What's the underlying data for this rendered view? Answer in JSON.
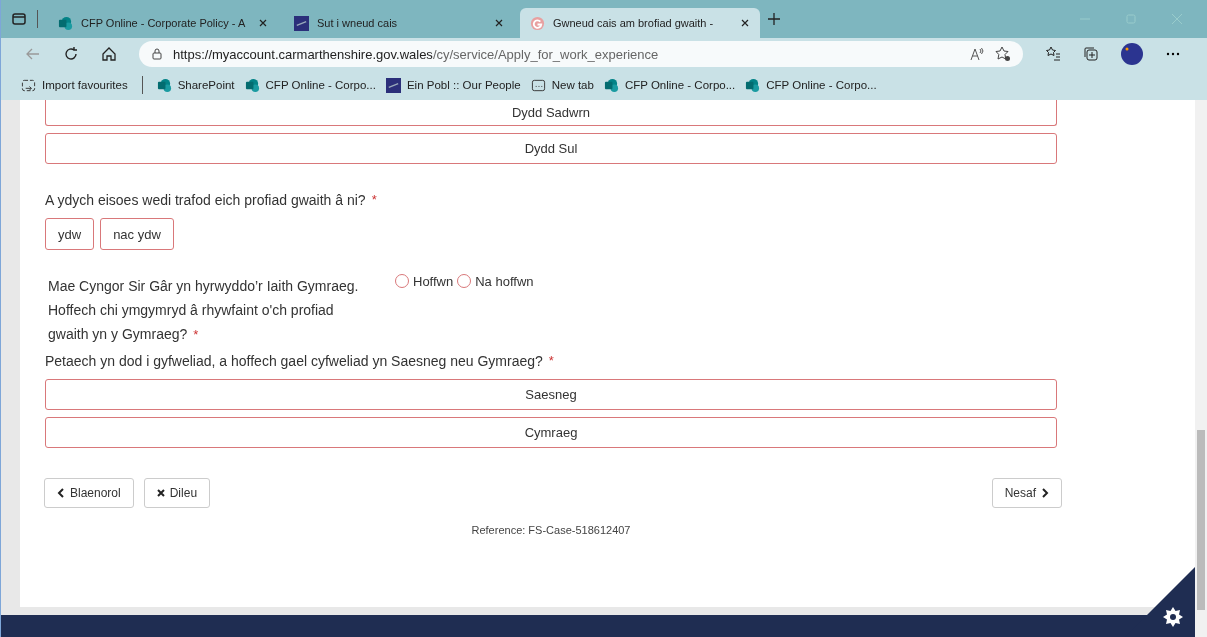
{
  "browser": {
    "tabs": [
      {
        "title": "CFP Online - Corporate Policy - A",
        "kind": "sharepoint",
        "selected": false
      },
      {
        "title": "Sut i wneud cais",
        "kind": "site",
        "selected": false
      },
      {
        "title": "Gwneud cais am brofiad gwaith -",
        "kind": "google",
        "selected": true
      }
    ],
    "url_host": "https://myaccount.carmarthenshire.gov.wales",
    "url_path": "/cy/service/Apply_for_work_experience",
    "favourites": [
      {
        "label": "Import favourites",
        "kind": "import"
      },
      {
        "label": "SharePoint",
        "kind": "sharepoint"
      },
      {
        "label": "CFP Online - Corpo...",
        "kind": "sharepoint"
      },
      {
        "label": "Ein Pobl :: Our People",
        "kind": "site"
      },
      {
        "label": "New tab",
        "kind": "newtab"
      },
      {
        "label": "CFP Online - Corpo...",
        "kind": "sharepoint"
      },
      {
        "label": "CFP Online - Corpo...",
        "kind": "sharepoint"
      }
    ]
  },
  "form": {
    "day_options": [
      {
        "label": "Dydd Sadwrn",
        "selected": false
      },
      {
        "label": "Dydd Sul",
        "selected": false
      }
    ],
    "q_discussed": {
      "label": "A ydych eisoes wedi trafod eich profiad gwaith â ni?",
      "required": "*",
      "options": [
        {
          "label": "ydw",
          "selected": false
        },
        {
          "label": "nac ydw",
          "selected": false
        }
      ]
    },
    "q_welsh": {
      "label": "Mae Cyngor Sir Gâr yn hyrwyddo’r Iaith Gymraeg. Hoffech chi ymgymryd â rhywfaint o'ch profiad gwaith yn y Gymraeg?",
      "required": "*",
      "options": [
        {
          "label": "Hoffwn",
          "selected": false
        },
        {
          "label": "Na hoffwn",
          "selected": false
        }
      ]
    },
    "q_interview": {
      "label": "Petaech yn dod i gyfweliad, a hoffech gael cyfweliad yn Saesneg neu Gymraeg?",
      "required": "*",
      "options": [
        {
          "label": "Saesneg",
          "selected": false
        },
        {
          "label": "Cymraeg",
          "selected": false
        }
      ]
    },
    "buttons": [
      {
        "label": "Blaenorol",
        "kind": "back"
      },
      {
        "label": "Dileu",
        "kind": "delete"
      },
      {
        "label": "Nesaf",
        "kind": "next"
      }
    ],
    "reference": "Reference: FS-Case-518612407"
  }
}
